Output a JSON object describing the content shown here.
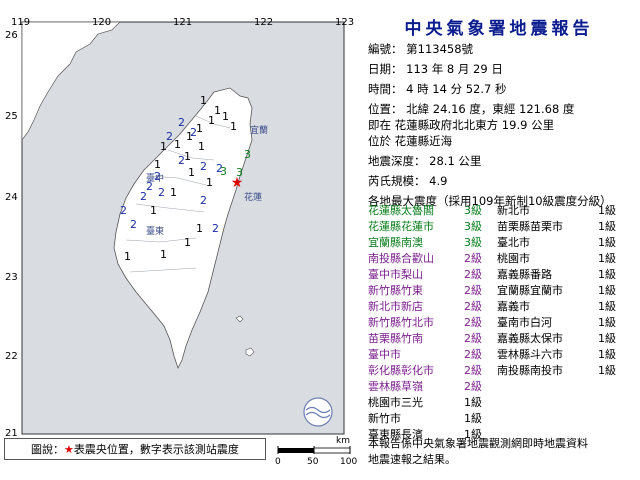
{
  "map": {
    "x_ticks": [
      "119",
      "120",
      "121",
      "122",
      "123"
    ],
    "y_ticks": [
      "26",
      "25",
      "24",
      "23",
      "22",
      "21"
    ],
    "intensity_markers": [
      {
        "v": "1",
        "c": "#000000"
      },
      {
        "v": "1",
        "c": "#000000"
      },
      {
        "v": "1",
        "c": "#000000"
      },
      {
        "v": "1",
        "c": "#000000"
      },
      {
        "v": "1",
        "c": "#000000"
      },
      {
        "v": "1",
        "c": "#000000"
      },
      {
        "v": "1",
        "c": "#000000"
      },
      {
        "v": "1",
        "c": "#000000"
      },
      {
        "v": "1",
        "c": "#000000"
      },
      {
        "v": "1",
        "c": "#000000"
      },
      {
        "v": "1",
        "c": "#000000"
      },
      {
        "v": "1",
        "c": "#000000"
      },
      {
        "v": "1",
        "c": "#000000"
      },
      {
        "v": "1",
        "c": "#000000"
      },
      {
        "v": "1",
        "c": "#000000"
      },
      {
        "v": "1",
        "c": "#000000"
      },
      {
        "v": "1",
        "c": "#000000"
      },
      {
        "v": "1",
        "c": "#000000"
      },
      {
        "v": "1",
        "c": "#000000"
      },
      {
        "v": "1",
        "c": "#000000"
      },
      {
        "v": "2",
        "c": "#1a2fa3"
      },
      {
        "v": "2",
        "c": "#1a2fa3"
      },
      {
        "v": "2",
        "c": "#1a2fa3"
      },
      {
        "v": "2",
        "c": "#1a2fa3"
      },
      {
        "v": "2",
        "c": "#1a2fa3"
      },
      {
        "v": "2",
        "c": "#1a2fa3"
      },
      {
        "v": "2",
        "c": "#1a2fa3"
      },
      {
        "v": "2",
        "c": "#1a2fa3"
      },
      {
        "v": "2",
        "c": "#1a2fa3"
      },
      {
        "v": "2",
        "c": "#1a2fa3"
      },
      {
        "v": "2",
        "c": "#1a2fa3"
      },
      {
        "v": "2",
        "c": "#1a2fa3"
      },
      {
        "v": "2",
        "c": "#1a2fa3"
      },
      {
        "v": "2",
        "c": "#1a2fa3"
      },
      {
        "v": "3",
        "c": "#0a7d1c"
      },
      {
        "v": "3",
        "c": "#0a7d1c"
      },
      {
        "v": "3",
        "c": "#0a7d1c"
      }
    ],
    "place_labels": [
      "宜蘭",
      "臺中",
      "花蓮",
      "臺東"
    ],
    "water_color": "#d9dde2",
    "land_color": "#ffffff",
    "epicenter_color": "#e00000"
  },
  "legend": {
    "prefix": "圖說：",
    "star": "★",
    "text": "表震央位置，數字表示該測站震度"
  },
  "scalebar": {
    "unit": "km",
    "labels": [
      "0",
      "50",
      "100"
    ]
  },
  "report": {
    "title": "中央氣象署地震報告",
    "rows": [
      "編號：  第113458號",
      "日期：  113 年  8 月  29 日",
      "時間：  4  時  14  分  52.7  秒",
      "位置：  北緯  24.16  度，東經  121.68  度",
      "即在  花蓮縣政府北北東方  19.9  公里",
      "位於  花蓮縣近海",
      "地震深度：  28.1  公里",
      "芮氏規模：  4.9",
      "各地最大震度（採用109年新制10級震度分級）"
    ],
    "left_col": [
      {
        "name": "花蓮縣太魯閣",
        "level": "3級",
        "color": "#0a7d1c"
      },
      {
        "name": "花蓮縣花蓮市",
        "level": "3級",
        "color": "#0a7d1c"
      },
      {
        "name": "宜蘭縣南澳",
        "level": "3級",
        "color": "#0a7d1c"
      },
      {
        "name": "南投縣合歡山",
        "level": "2級",
        "color": "#7a1f8c"
      },
      {
        "name": "臺中市梨山",
        "level": "2級",
        "color": "#7a1f8c"
      },
      {
        "name": "新竹縣竹東",
        "level": "2級",
        "color": "#7a1f8c"
      },
      {
        "name": "新北市新店",
        "level": "2級",
        "color": "#7a1f8c"
      },
      {
        "name": "新竹縣竹北市",
        "level": "2級",
        "color": "#7a1f8c"
      },
      {
        "name": "苗栗縣竹南",
        "level": "2級",
        "color": "#7a1f8c"
      },
      {
        "name": "臺中市",
        "level": "2級",
        "color": "#7a1f8c"
      },
      {
        "name": "彰化縣彰化市",
        "level": "2級",
        "color": "#7a1f8c"
      },
      {
        "name": "雲林縣草嶺",
        "level": "2級",
        "color": "#7a1f8c"
      },
      {
        "name": "桃園市三光",
        "level": "1級",
        "color": "#000000"
      },
      {
        "name": "新竹市",
        "level": "1級",
        "color": "#000000"
      },
      {
        "name": "臺東縣長濱",
        "level": "1級",
        "color": "#000000"
      }
    ],
    "right_col": [
      {
        "name": "新北市",
        "level": "1級"
      },
      {
        "name": "苗栗縣苗栗市",
        "level": "1級"
      },
      {
        "name": "臺北市",
        "level": "1級"
      },
      {
        "name": "桃園市",
        "level": "1級"
      },
      {
        "name": "嘉義縣番路",
        "level": "1級"
      },
      {
        "name": "宜蘭縣宜蘭市",
        "level": "1級"
      },
      {
        "name": "嘉義市",
        "level": "1級"
      },
      {
        "name": "臺南市白河",
        "level": "1級"
      },
      {
        "name": "嘉義縣太保市",
        "level": "1級"
      },
      {
        "name": "雲林縣斗六市",
        "level": "1級"
      },
      {
        "name": "南投縣南投市",
        "level": "1級"
      }
    ],
    "footer": [
      "本報告係中央氣象署地震觀測網即時地震資料",
      "地震速報之結果。"
    ]
  }
}
